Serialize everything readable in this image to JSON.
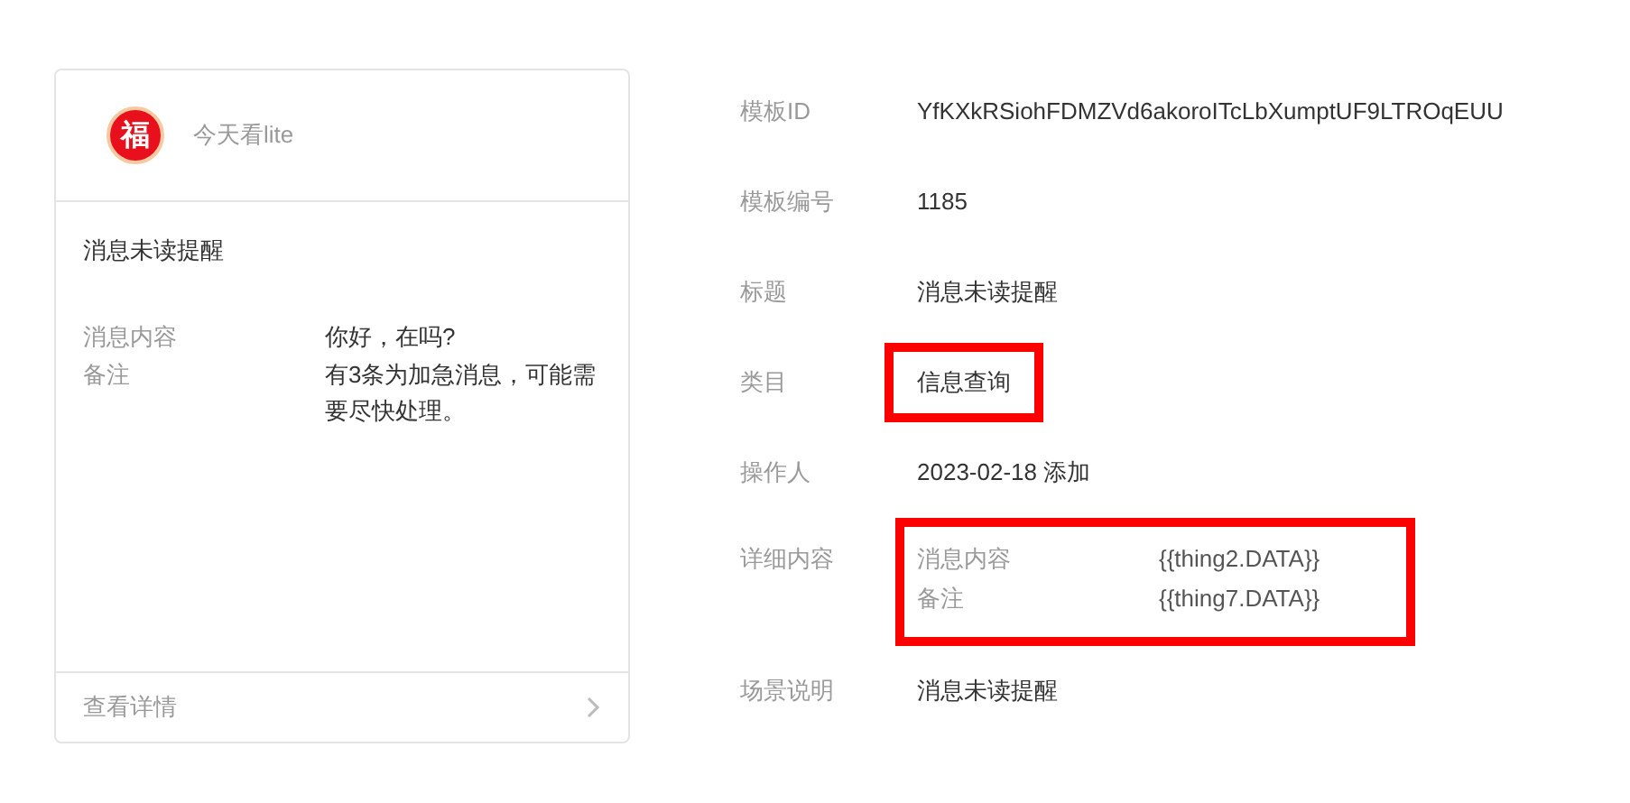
{
  "preview_card": {
    "logo": "福",
    "account_name": "今天看lite",
    "title": "消息未读提醒",
    "fields": [
      {
        "label": "消息内容",
        "value": "你好，在吗?"
      },
      {
        "label": "备注",
        "value": "有3条为加急消息，可能需要尽快处理。"
      }
    ],
    "footer_link": "查看详情"
  },
  "details": [
    {
      "kind": "text",
      "label": "模板ID",
      "value": "YfKXkRSiohFDMZVd6akoroITcLbXumptUF9LTROqEUU",
      "highlighted": false
    },
    {
      "kind": "text",
      "label": "模板编号",
      "value": "1185",
      "highlighted": false
    },
    {
      "kind": "text",
      "label": "标题",
      "value": "消息未读提醒",
      "highlighted": false
    },
    {
      "kind": "text",
      "label": "类目",
      "value": "信息查询",
      "highlighted": true
    },
    {
      "kind": "text",
      "label": "操作人",
      "value": "2023-02-18 添加",
      "highlighted": false
    },
    {
      "kind": "fields",
      "label": "详细内容",
      "highlighted": true,
      "fields": [
        {
          "label": "消息内容",
          "value": "{{thing2.DATA}}"
        },
        {
          "label": "备注",
          "value": "{{thing7.DATA}}"
        }
      ]
    },
    {
      "kind": "text",
      "label": "场景说明",
      "value": "消息未读提醒",
      "highlighted": false
    }
  ]
}
